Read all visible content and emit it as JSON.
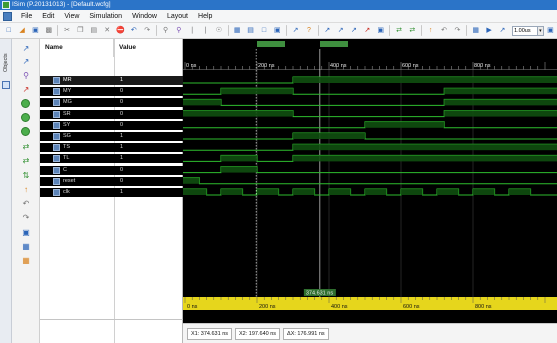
{
  "window": {
    "title": "ISim (P.20131013) - [Default.wcfg]"
  },
  "menu": [
    "File",
    "Edit",
    "View",
    "Simulation",
    "Window",
    "Layout",
    "Help"
  ],
  "toolbar": {
    "time_value": "1.00us"
  },
  "left_tab": {
    "objects_label": "Objects"
  },
  "columns": {
    "name": "Name",
    "value": "Value"
  },
  "signals": [
    {
      "name": "MR",
      "value": "1"
    },
    {
      "name": "MY",
      "value": "0"
    },
    {
      "name": "MG",
      "value": "0"
    },
    {
      "name": "SR",
      "value": "0"
    },
    {
      "name": "SY",
      "value": "0"
    },
    {
      "name": "SG",
      "value": "1"
    },
    {
      "name": "TS",
      "value": "1"
    },
    {
      "name": "TL",
      "value": "1"
    },
    {
      "name": "C",
      "value": "0"
    },
    {
      "name": "reset",
      "value": "0"
    },
    {
      "name": "clk",
      "value": "1"
    }
  ],
  "ruler": {
    "top_labels": [
      "0 ns",
      "200 ns",
      "400 ns",
      "600 ns",
      "800 ns"
    ],
    "bottom_labels": [
      "0 ns",
      "200 ns",
      "400 ns",
      "600 ns",
      "800 ns"
    ],
    "marker_label_bottom": "374.631 ns"
  },
  "status": {
    "x1": "X1: 374.631 ns",
    "x2": "X2: 197.640 ns",
    "dx": "ΔX: 176.991 ns"
  },
  "colors": {
    "wave": "#2ebd2e",
    "titlebar": "#2b74c8",
    "ruler_bottom": "#e6d61c"
  }
}
